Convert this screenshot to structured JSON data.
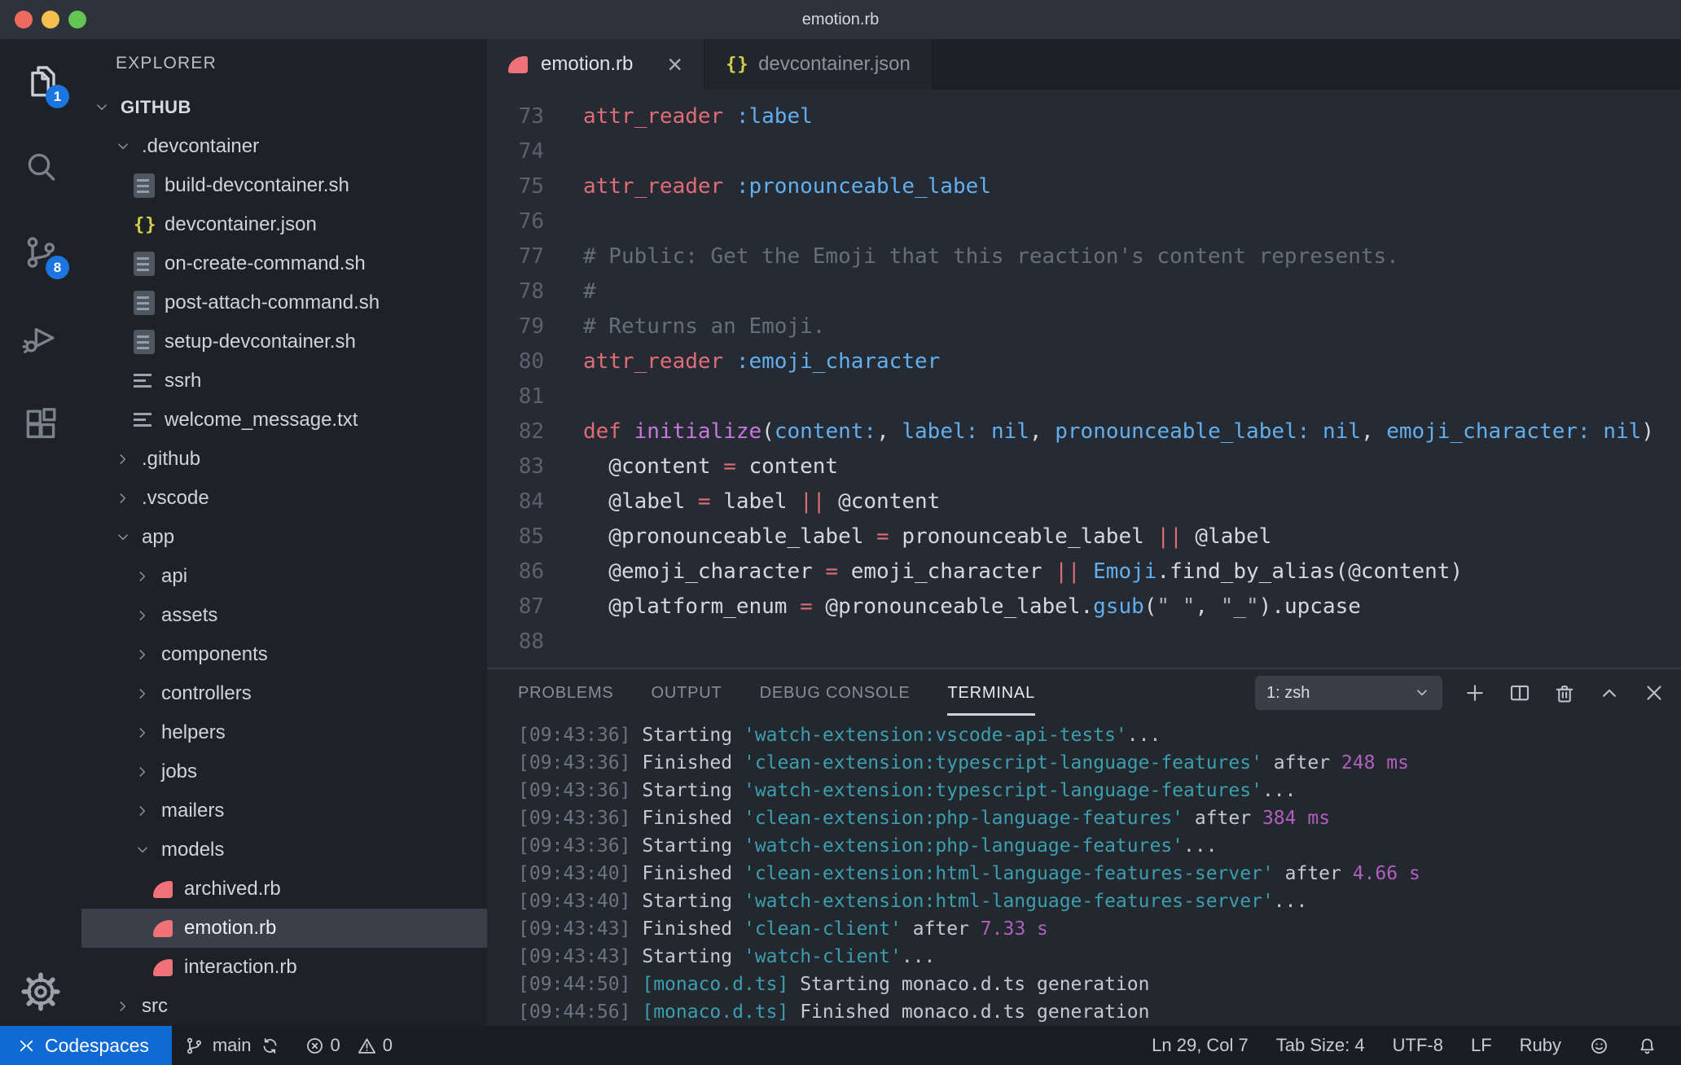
{
  "window": {
    "title": "emotion.rb"
  },
  "colors": {
    "accent_blue": "#1b76e0",
    "codespaces_blue": "#0f6ad3",
    "ruby_pink": "#f07178",
    "json_yellow": "#d6cf4b",
    "keyword_red": "#e06c75",
    "symbol_blue": "#61afef",
    "method_purple": "#c678dd",
    "terminal_teal": "#3c9fb0",
    "terminal_magenta": "#b25fc0"
  },
  "activity_bar": {
    "items": [
      {
        "name": "explorer",
        "icon": "files",
        "badge": "1",
        "active": true
      },
      {
        "name": "search",
        "icon": "search"
      },
      {
        "name": "source-control",
        "icon": "source-control",
        "badge": "8"
      },
      {
        "name": "run-and-debug",
        "icon": "debug"
      },
      {
        "name": "extensions",
        "icon": "extensions"
      }
    ],
    "bottom": [
      {
        "name": "manage",
        "icon": "gear"
      }
    ]
  },
  "sidebar": {
    "header": "EXPLORER",
    "items": [
      {
        "label": "GITHUB",
        "indent": 0,
        "chev": "open",
        "kind": "root"
      },
      {
        "label": ".devcontainer",
        "indent": 1,
        "chev": "open"
      },
      {
        "label": "build-devcontainer.sh",
        "indent": 2,
        "icon": "shell"
      },
      {
        "label": "devcontainer.json",
        "indent": 2,
        "icon": "json"
      },
      {
        "label": "on-create-command.sh",
        "indent": 2,
        "icon": "shell"
      },
      {
        "label": "post-attach-command.sh",
        "indent": 2,
        "icon": "shell"
      },
      {
        "label": "setup-devcontainer.sh",
        "indent": 2,
        "icon": "shell"
      },
      {
        "label": "ssrh",
        "indent": 2,
        "icon": "lines"
      },
      {
        "label": "welcome_message.txt",
        "indent": 2,
        "icon": "lines"
      },
      {
        "label": ".github",
        "indent": 1,
        "chev": "closed"
      },
      {
        "label": ".vscode",
        "indent": 1,
        "chev": "closed"
      },
      {
        "label": "app",
        "indent": 1,
        "chev": "open"
      },
      {
        "label": "api",
        "indent": 2,
        "chev": "closed"
      },
      {
        "label": "assets",
        "indent": 2,
        "chev": "closed"
      },
      {
        "label": "components",
        "indent": 2,
        "chev": "closed"
      },
      {
        "label": "controllers",
        "indent": 2,
        "chev": "closed"
      },
      {
        "label": "helpers",
        "indent": 2,
        "chev": "closed"
      },
      {
        "label": "jobs",
        "indent": 2,
        "chev": "closed"
      },
      {
        "label": "mailers",
        "indent": 2,
        "chev": "closed"
      },
      {
        "label": "models",
        "indent": 2,
        "chev": "open"
      },
      {
        "label": "archived.rb",
        "indent": 3,
        "icon": "ruby"
      },
      {
        "label": "emotion.rb",
        "indent": 3,
        "icon": "ruby",
        "selected": true
      },
      {
        "label": "interaction.rb",
        "indent": 3,
        "icon": "ruby"
      },
      {
        "label": "src",
        "indent": 1,
        "chev": "closed"
      }
    ]
  },
  "editor": {
    "tabs": [
      {
        "label": "emotion.rb",
        "icon": "ruby",
        "active": true,
        "close": "×"
      },
      {
        "label": "devcontainer.json",
        "icon": "json",
        "active": false
      }
    ],
    "code": [
      {
        "no": "73",
        "seg": [
          [
            "attr_reader",
            "k"
          ],
          [
            " ",
            "f"
          ],
          [
            ":label",
            "b"
          ]
        ]
      },
      {
        "no": "74",
        "seg": []
      },
      {
        "no": "75",
        "seg": [
          [
            "attr_reader",
            "k"
          ],
          [
            " ",
            "f"
          ],
          [
            ":pronounceable_label",
            "b"
          ]
        ]
      },
      {
        "no": "76",
        "seg": []
      },
      {
        "no": "77",
        "seg": [
          [
            "# Public: Get the Emoji that this reaction's content represents.",
            "c"
          ]
        ]
      },
      {
        "no": "78",
        "seg": [
          [
            "#",
            "c"
          ]
        ]
      },
      {
        "no": "79",
        "seg": [
          [
            "# Returns an Emoji.",
            "c"
          ]
        ]
      },
      {
        "no": "80",
        "seg": [
          [
            "attr_reader",
            "k"
          ],
          [
            " ",
            "f"
          ],
          [
            ":emoji_character",
            "b"
          ]
        ]
      },
      {
        "no": "81",
        "seg": []
      },
      {
        "no": "82",
        "seg": [
          [
            "def",
            "k"
          ],
          [
            " ",
            "f"
          ],
          [
            "initialize",
            "p"
          ],
          [
            "(",
            "f"
          ],
          [
            "content:",
            "b"
          ],
          [
            ", ",
            "f"
          ],
          [
            "label:",
            "b"
          ],
          [
            " ",
            "f"
          ],
          [
            "nil",
            "b"
          ],
          [
            ", ",
            "f"
          ],
          [
            "pronounceable_label:",
            "b"
          ],
          [
            " ",
            "f"
          ],
          [
            "nil",
            "b"
          ],
          [
            ", ",
            "f"
          ],
          [
            "emoji_character:",
            "b"
          ],
          [
            " ",
            "f"
          ],
          [
            "nil",
            "b"
          ],
          [
            ")",
            "f"
          ]
        ]
      },
      {
        "no": "83",
        "seg": [
          [
            "  @content ",
            "f"
          ],
          [
            "=",
            "k"
          ],
          [
            " content",
            "f"
          ]
        ]
      },
      {
        "no": "84",
        "seg": [
          [
            "  @label ",
            "f"
          ],
          [
            "=",
            "k"
          ],
          [
            " label ",
            "f"
          ],
          [
            "||",
            "k"
          ],
          [
            " @content",
            "f"
          ]
        ]
      },
      {
        "no": "85",
        "seg": [
          [
            "  @pronounceable_label ",
            "f"
          ],
          [
            "=",
            "k"
          ],
          [
            " pronounceable_label ",
            "f"
          ],
          [
            "||",
            "k"
          ],
          [
            " @label",
            "f"
          ]
        ]
      },
      {
        "no": "86",
        "seg": [
          [
            "  @emoji_character ",
            "f"
          ],
          [
            "=",
            "k"
          ],
          [
            " emoji_character ",
            "f"
          ],
          [
            "||",
            "k"
          ],
          [
            " ",
            "f"
          ],
          [
            "Emoji",
            "b"
          ],
          [
            ".find_by_alias(@content)",
            "f"
          ]
        ]
      },
      {
        "no": "87",
        "seg": [
          [
            "  @platform_enum ",
            "f"
          ],
          [
            "=",
            "k"
          ],
          [
            " @pronounceable_label.",
            "f"
          ],
          [
            "gsub",
            "b"
          ],
          [
            "(",
            "f"
          ],
          [
            "\" \"",
            "s"
          ],
          [
            ", ",
            "f"
          ],
          [
            "\"_\"",
            "s"
          ],
          [
            ").upcase",
            "f"
          ]
        ]
      },
      {
        "no": "88",
        "seg": []
      }
    ]
  },
  "panel": {
    "tabs": [
      {
        "label": "PROBLEMS",
        "active": false
      },
      {
        "label": "OUTPUT",
        "active": false
      },
      {
        "label": "DEBUG CONSOLE",
        "active": false
      },
      {
        "label": "TERMINAL",
        "active": true
      }
    ],
    "shell_select": "1: zsh",
    "actions": [
      {
        "name": "new-terminal",
        "icon": "plus"
      },
      {
        "name": "split-terminal",
        "icon": "split"
      },
      {
        "name": "kill-terminal",
        "icon": "trash"
      },
      {
        "name": "maximize-panel",
        "icon": "chevron-up"
      },
      {
        "name": "close-panel",
        "icon": "close"
      }
    ],
    "terminal": [
      [
        [
          "[09:43:36]",
          "dim"
        ],
        [
          " Starting ",
          "fg"
        ],
        [
          "'watch-extension:vscode-api-tests'",
          "teal"
        ],
        [
          "...",
          "fg"
        ]
      ],
      [
        [
          "[09:43:36]",
          "dim"
        ],
        [
          " Finished ",
          "fg"
        ],
        [
          "'clean-extension:typescript-language-features'",
          "teal"
        ],
        [
          " after ",
          "fg"
        ],
        [
          "248 ms",
          "mag"
        ]
      ],
      [
        [
          "[09:43:36]",
          "dim"
        ],
        [
          " Starting ",
          "fg"
        ],
        [
          "'watch-extension:typescript-language-features'",
          "teal"
        ],
        [
          "...",
          "fg"
        ]
      ],
      [
        [
          "[09:43:36]",
          "dim"
        ],
        [
          " Finished ",
          "fg"
        ],
        [
          "'clean-extension:php-language-features'",
          "teal"
        ],
        [
          " after ",
          "fg"
        ],
        [
          "384 ms",
          "mag"
        ]
      ],
      [
        [
          "[09:43:36]",
          "dim"
        ],
        [
          " Starting ",
          "fg"
        ],
        [
          "'watch-extension:php-language-features'",
          "teal"
        ],
        [
          "...",
          "fg"
        ]
      ],
      [
        [
          "[09:43:40]",
          "dim"
        ],
        [
          " Finished ",
          "fg"
        ],
        [
          "'clean-extension:html-language-features-server'",
          "teal"
        ],
        [
          " after ",
          "fg"
        ],
        [
          "4.66 s",
          "mag"
        ]
      ],
      [
        [
          "[09:43:40]",
          "dim"
        ],
        [
          " Starting ",
          "fg"
        ],
        [
          "'watch-extension:html-language-features-server'",
          "teal"
        ],
        [
          "...",
          "fg"
        ]
      ],
      [
        [
          "[09:43:43]",
          "dim"
        ],
        [
          " Finished ",
          "fg"
        ],
        [
          "'clean-client'",
          "teal"
        ],
        [
          " after ",
          "fg"
        ],
        [
          "7.33 s",
          "mag"
        ]
      ],
      [
        [
          "[09:43:43]",
          "dim"
        ],
        [
          " Starting ",
          "fg"
        ],
        [
          "'watch-client'",
          "teal"
        ],
        [
          "...",
          "fg"
        ]
      ],
      [
        [
          "[09:44:50]",
          "dim"
        ],
        [
          " ",
          "fg"
        ],
        [
          "[monaco.d.ts]",
          "teal"
        ],
        [
          " Starting monaco.d.ts generation",
          "fg"
        ]
      ],
      [
        [
          "[09:44:56]",
          "dim"
        ],
        [
          " ",
          "fg"
        ],
        [
          "[monaco.d.ts]",
          "teal"
        ],
        [
          " Finished monaco.d.ts generation",
          "fg"
        ]
      ]
    ]
  },
  "status_bar": {
    "left": [
      {
        "name": "codespaces",
        "icon": "remote",
        "label": "Codespaces",
        "accent": true
      },
      {
        "name": "git-branch",
        "icon": "branch",
        "label": "main",
        "icon_after": "sync"
      },
      {
        "name": "problems",
        "parts": [
          {
            "icon": "error",
            "value": "0"
          },
          {
            "icon": "warning",
            "value": "0"
          }
        ]
      }
    ],
    "right": [
      {
        "name": "cursor-position",
        "label": "Ln 29, Col 7"
      },
      {
        "name": "indentation",
        "label": "Tab Size: 4"
      },
      {
        "name": "encoding",
        "label": "UTF-8"
      },
      {
        "name": "eol",
        "label": "LF"
      },
      {
        "name": "language-mode",
        "label": "Ruby"
      },
      {
        "name": "feedback",
        "icon": "smiley"
      },
      {
        "name": "notifications",
        "icon": "bell"
      }
    ]
  }
}
